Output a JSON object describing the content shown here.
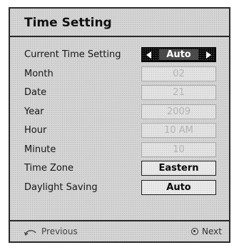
{
  "title": "Time Setting",
  "rows": [
    {
      "label": "Current Time Setting",
      "value": "Auto"
    },
    {
      "label": "Month",
      "value": "02"
    },
    {
      "label": "Date",
      "value": "21"
    },
    {
      "label": "Year",
      "value": "2009"
    },
    {
      "label": "Hour",
      "value": "10 AM"
    },
    {
      "label": "Minute",
      "value": "10"
    },
    {
      "label": "Time Zone",
      "value": "Eastern"
    },
    {
      "label": "Daylight Saving",
      "value": "Auto"
    }
  ],
  "footer": {
    "previous": "Previous",
    "next": "Next",
    "previous_icon": "return-arrow-icon",
    "next_icon": "ok-button-icon"
  }
}
